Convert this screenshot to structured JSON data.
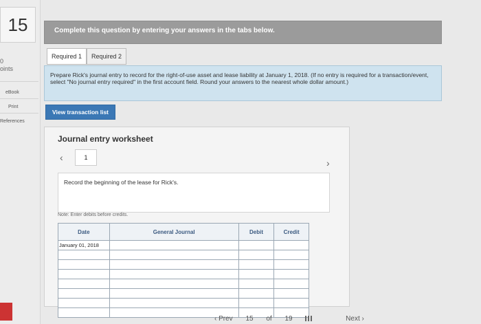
{
  "rail": {
    "question_number": "15",
    "points_frag": "0",
    "points_label": "oints",
    "ebook": "eBook",
    "print": "Print",
    "references": "References"
  },
  "instruction": "Complete this question by entering your answers in the tabs below.",
  "tabs": [
    "Required 1",
    "Required 2"
  ],
  "prompt": "Prepare Rick's journal entry to record for the right-of-use asset and lease liability at January 1, 2018. (If no entry is required for a transaction/event, select \"No journal entry required\" in the first account field. Round your answers to the nearest whole dollar amount.)",
  "view_transaction_label": "View transaction list",
  "worksheet": {
    "title": "Journal entry worksheet",
    "prev_icon": "‹",
    "next_icon": "›",
    "page": "1",
    "description": "Record the beginning of the lease for Rick's.",
    "note": "Note: Enter debits before credits.",
    "columns": [
      "Date",
      "General Journal",
      "Debit",
      "Credit"
    ],
    "rows": [
      [
        "January 01, 2018",
        "",
        "",
        ""
      ],
      [
        "",
        "",
        "",
        ""
      ],
      [
        "",
        "",
        "",
        ""
      ],
      [
        "",
        "",
        "",
        ""
      ],
      [
        "",
        "",
        "",
        ""
      ],
      [
        "",
        "",
        "",
        ""
      ],
      [
        "",
        "",
        "",
        ""
      ],
      [
        "",
        "",
        "",
        ""
      ]
    ]
  },
  "bottom": {
    "prev": "‹ Prev",
    "page": "15",
    "of": "of",
    "total": "19",
    "next": "Next ›"
  }
}
